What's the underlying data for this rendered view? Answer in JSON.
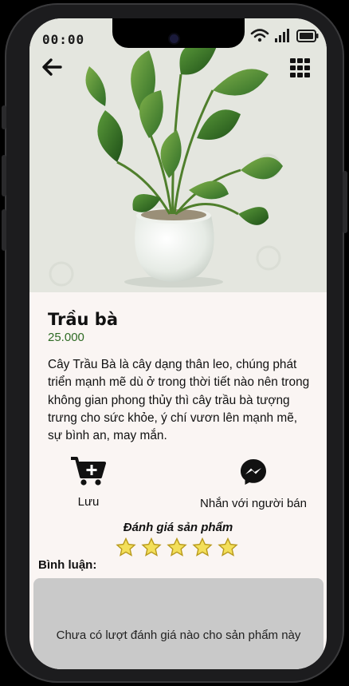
{
  "status_bar": {
    "time": "00:00"
  },
  "header": {
    "back_icon": "arrow-left-icon",
    "menu_icon": "grid-icon"
  },
  "product": {
    "name": "Trầu bà",
    "price": "25.000",
    "description": "Cây Trầu Bà là cây dạng thân leo, chúng phát triển mạnh mẽ dù ở trong thời tiết nào nên trong không gian phong thủy thì cây trầu bà tượng trưng cho sức khỏe, ý chí vươn lên mạnh mẽ, sự bình an, may mắn."
  },
  "actions": {
    "save_label": "Lưu",
    "save_icon": "cart-plus-icon",
    "message_label": "Nhắn với người bán",
    "message_icon": "messenger-icon"
  },
  "rating": {
    "title": "Đánh giá sản phẩm",
    "star_count": 5,
    "selected": 0
  },
  "comments": {
    "label": "Bình luận:",
    "empty_text": "Chưa có lượt đánh giá nào cho sản phẩm này"
  },
  "colors": {
    "price": "#2f6b25",
    "star_fill": "#f3df5a",
    "star_stroke": "#b89a1c",
    "comment_bg": "#c9c9c9"
  }
}
